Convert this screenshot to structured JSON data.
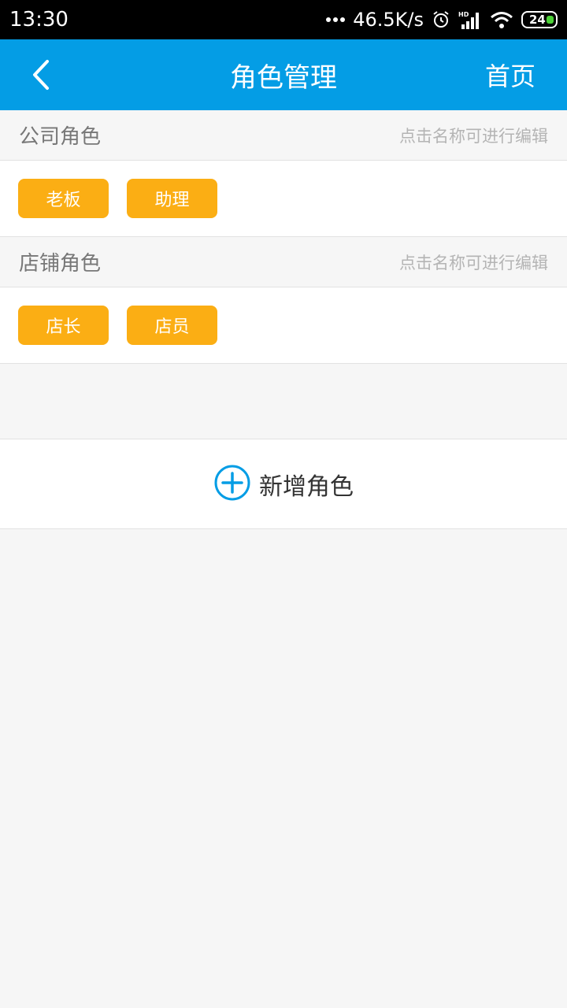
{
  "status_bar": {
    "time": "13:30",
    "network_speed": "46.5K/s",
    "battery_level": "24",
    "icons": [
      "more-dots-icon",
      "alarm-icon",
      "hd-signal-icon",
      "wifi-icon",
      "battery-icon"
    ]
  },
  "app_bar": {
    "title": "角色管理",
    "home_label": "首页",
    "back_icon": "chevron-left-icon",
    "color": "#049de5"
  },
  "company_section": {
    "title": "公司角色",
    "hint": "点击名称可进行编辑",
    "roles": [
      "老板",
      "助理"
    ]
  },
  "store_section": {
    "title": "店铺角色",
    "hint": "点击名称可进行编辑",
    "roles": [
      "店长",
      "店员"
    ]
  },
  "add_role": {
    "label": "新增角色",
    "icon": "plus-circle-icon",
    "icon_color": "#049de5"
  },
  "colors": {
    "tag": "#fbae14",
    "background": "#f6f6f6"
  }
}
